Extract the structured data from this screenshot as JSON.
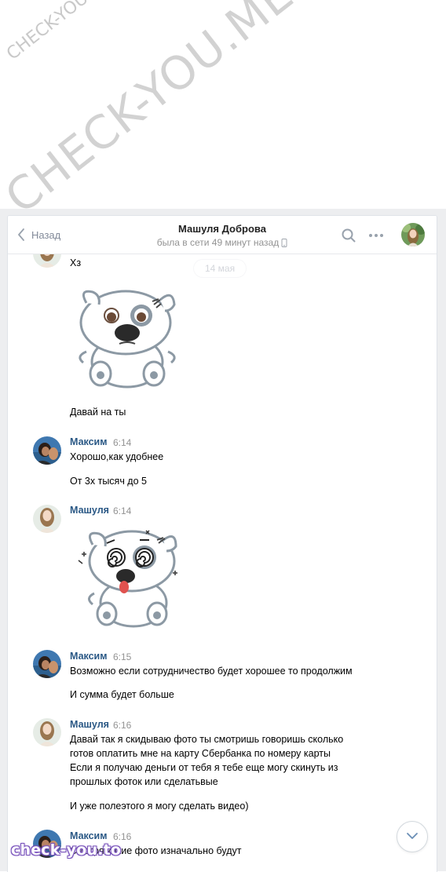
{
  "watermarks": {
    "small": "CHECK-YOU.ME",
    "big": "CHECK-YOU.ME"
  },
  "logo": "check-you.to",
  "header": {
    "back_label": "Назад",
    "peer_name": "Машуля Доброва",
    "peer_status": "была в сети 49 минут назад",
    "icons": [
      "chevron-left-icon",
      "phone-icon",
      "search-icon",
      "more-icon"
    ]
  },
  "date_divider": "14 мая",
  "messages": {
    "m0": {
      "text": "Хз"
    },
    "m1": {
      "text": "Давай на ты"
    },
    "m2": {
      "author": "Максим",
      "time": "6:14",
      "line1": "Хорошо,как удобнее",
      "line2": "От 3х тысяч до 5"
    },
    "m3": {
      "author": "Машуля",
      "time": "6:14"
    },
    "m4": {
      "author": "Максим",
      "time": "6:15",
      "line1": "Возможно если сотрудничество будет хорошее то продолжим",
      "line2": "И сумма будет больше"
    },
    "m5": {
      "author": "Машуля",
      "time": "6:16",
      "line1": "Давай так я скидываю фото ты смотришь говоришь сколько",
      "line2": "готов оплатить мне на карту Сбербанка по номеру карты",
      "line3": "Если я получаю деньги от тебя я тебе еще могу скинуть из",
      "line4": "прошлых фоток или сделатьвые",
      "line5": "И уже полеэтого я могу сделать видео)"
    },
    "m6": {
      "author": "Максим",
      "time": "6:16",
      "line1": "Смотря какие фото изначально будут"
    }
  },
  "stickers": [
    "sticker-dog-confused",
    "sticker-dog-dizzy"
  ],
  "colors": {
    "link": "#2a5885",
    "muted": "#939393",
    "frame": "#edeef0",
    "watermark": "#c9c9c9"
  }
}
